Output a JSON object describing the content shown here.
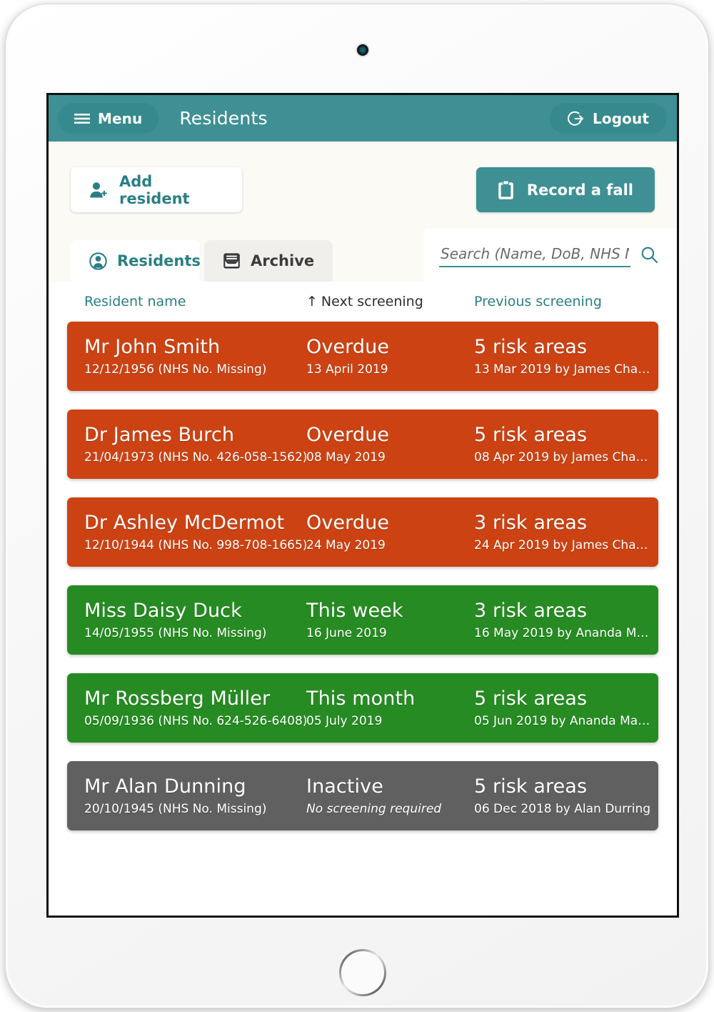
{
  "device": {
    "camera_label": "front-camera",
    "home_button_label": "home-button"
  },
  "header": {
    "menu_label": "Menu",
    "title": "Residents",
    "logout_label": "Logout",
    "background_color": "#3e9094"
  },
  "actions": {
    "add_resident_label": "Add resident",
    "record_fall_label": "Record a fall",
    "accent_color": "#2a7f84"
  },
  "tabs": [
    {
      "label": "Residents",
      "icon": "person-circle-icon",
      "active": true
    },
    {
      "label": "Archive",
      "icon": "archive-box-icon",
      "active": false
    }
  ],
  "search": {
    "placeholder": "Search (Name, DoB, NHS No.)",
    "value": "",
    "icon": "search-icon"
  },
  "table": {
    "columns": {
      "name": "Resident name",
      "next": "Next screening",
      "previous": "Previous screening",
      "sort_indicator": "↑",
      "sorted_by": "Next screening"
    },
    "rows": [
      {
        "status": "red",
        "name": "Mr John Smith",
        "details": "12/12/1956 (NHS No. Missing)",
        "next_status": "Overdue",
        "next_date": "13 April 2019",
        "risk": "5 risk areas",
        "previous": "13 Mar 2019 by James Cha…",
        "color": "#cc4213"
      },
      {
        "status": "red",
        "name": "Dr James Burch",
        "details": "21/04/1973 (NHS No. 426-058-1562)",
        "next_status": "Overdue",
        "next_date": "08 May 2019",
        "risk": "5 risk areas",
        "previous": "08 Apr 2019 by James Cha…",
        "color": "#cc4213"
      },
      {
        "status": "red",
        "name": "Dr Ashley McDermot",
        "details": "12/10/1944 (NHS No. 998-708-1665)",
        "next_status": "Overdue",
        "next_date": "24 May 2019",
        "risk": "3 risk areas",
        "previous": "24 Apr 2019 by James Cha…",
        "color": "#cc4213"
      },
      {
        "status": "green",
        "name": "Miss Daisy Duck",
        "details": "14/05/1955 (NHS No. Missing)",
        "next_status": "This week",
        "next_date": "16 June 2019",
        "risk": "3 risk areas",
        "previous": "16 May 2019 by Ananda M…",
        "color": "#268b22"
      },
      {
        "status": "green",
        "name": "Mr Rossberg Müller",
        "details": "05/09/1936 (NHS No. 624-526-6408)",
        "next_status": "This month",
        "next_date": "05 July 2019",
        "risk": "5 risk areas",
        "previous": "05 Jun 2019 by Ananda Ma…",
        "color": "#268b22"
      },
      {
        "status": "grey",
        "name": "Mr Alan Dunning",
        "details": "20/10/1945 (NHS No. Missing)",
        "next_status": "Inactive",
        "next_date": "No screening required",
        "next_date_italic": true,
        "risk": "5 risk areas",
        "previous": "06 Dec 2018 by Alan Durring",
        "color": "#606060"
      }
    ]
  }
}
